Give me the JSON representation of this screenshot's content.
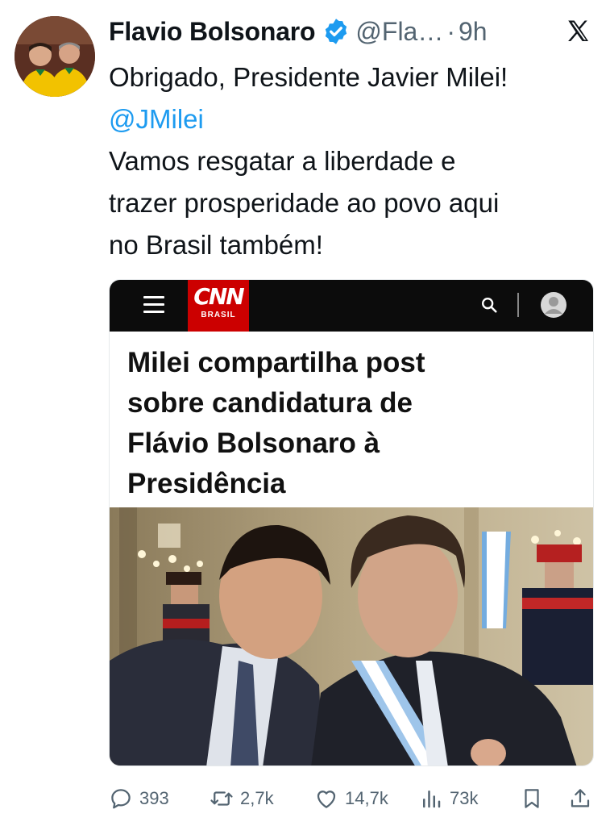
{
  "tweet": {
    "author_name": "Flavio Bolsonaro",
    "handle": "@Fla…",
    "separator": "·",
    "time": "9h",
    "text_lines": [
      "Obrigado, Presidente Javier Milei!",
      "@JMilei",
      "Vamos resgatar a liberdade e",
      "trazer prosperidade ao povo aqui",
      "no Brasil também!"
    ]
  },
  "card": {
    "logo_main": "CNN",
    "logo_sub": "BRASIL",
    "headline_lines": [
      "Milei compartilha post",
      "sobre candidatura de",
      "Flávio Bolsonaro à",
      "Presidência"
    ]
  },
  "actions": {
    "replies": "393",
    "reposts": "2,7k",
    "likes": "14,7k",
    "views": "73k"
  },
  "icons": {
    "verified": "verified-badge-icon",
    "platform": "x-logo-icon",
    "menu": "hamburger-menu-icon",
    "search": "search-icon",
    "account": "user-icon",
    "reply": "reply-icon",
    "repost": "repost-icon",
    "like": "heart-icon",
    "views": "views-icon",
    "bookmark": "bookmark-icon",
    "share": "share-icon"
  },
  "colors": {
    "text": "#0f1419",
    "secondary": "#536471",
    "accent": "#1d9bf0",
    "cnn_red": "#cc0000",
    "cnn_bar": "#0c0c0c"
  }
}
